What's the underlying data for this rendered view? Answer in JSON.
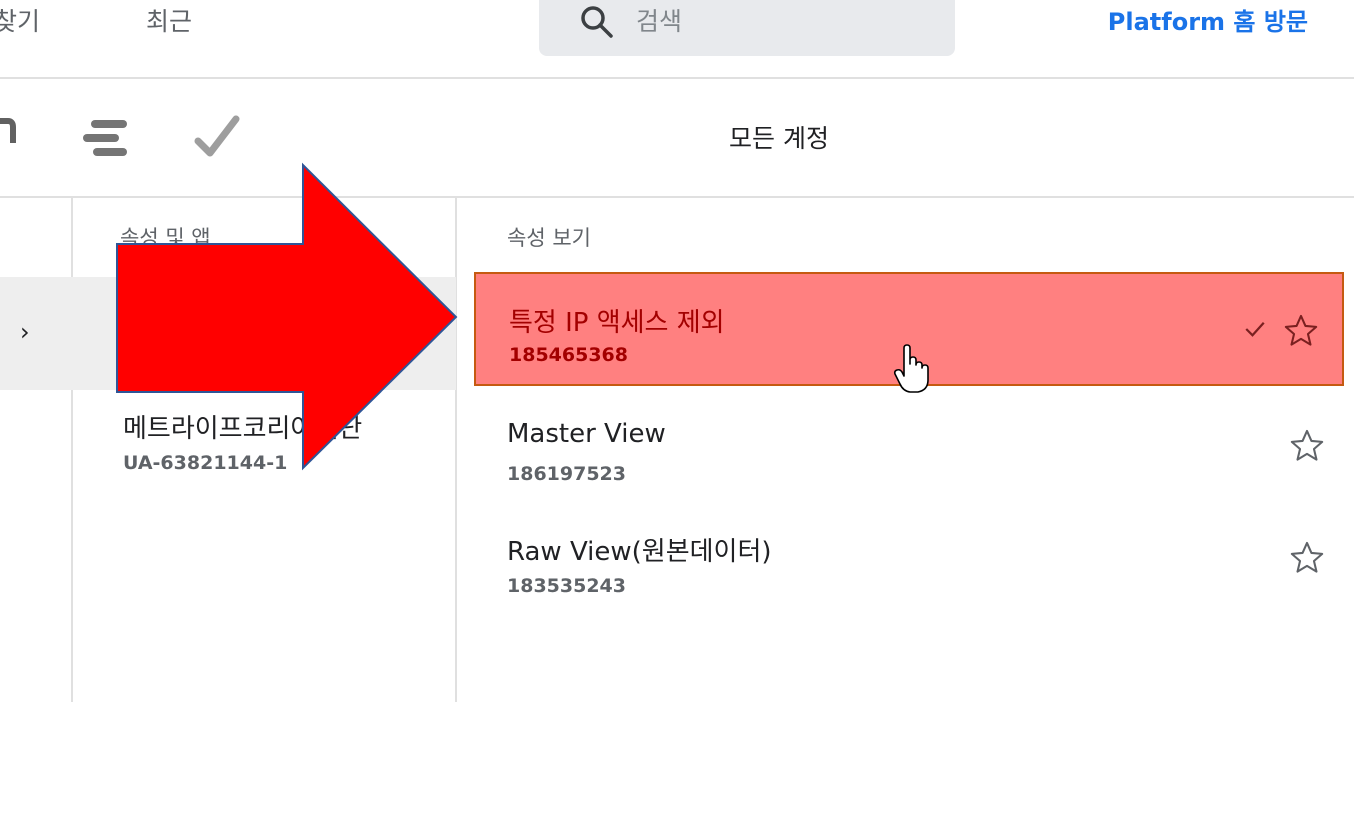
{
  "header": {
    "tab_favorites": "찾기",
    "tab_recent": "최근",
    "search_placeholder": "검색",
    "platform_link": "Platform 홈 방문"
  },
  "toolbar": {
    "title": "모든 계정"
  },
  "columns": {
    "property_header": "속성 및 앱",
    "view_header": "속성 보기"
  },
  "property": {
    "name": "메트라이프코리아재단",
    "id": "UA-63821144-1"
  },
  "views": [
    {
      "name": "특정 IP 액세스 제외",
      "id": "185465368",
      "selected": true
    },
    {
      "name": "Master View",
      "id": "186197523"
    },
    {
      "name": "Raw View(원본데이터)",
      "id": "183535243"
    }
  ],
  "annotation": {
    "arrow_color": "#ff0000",
    "highlight_color": "#ff7a7a"
  }
}
